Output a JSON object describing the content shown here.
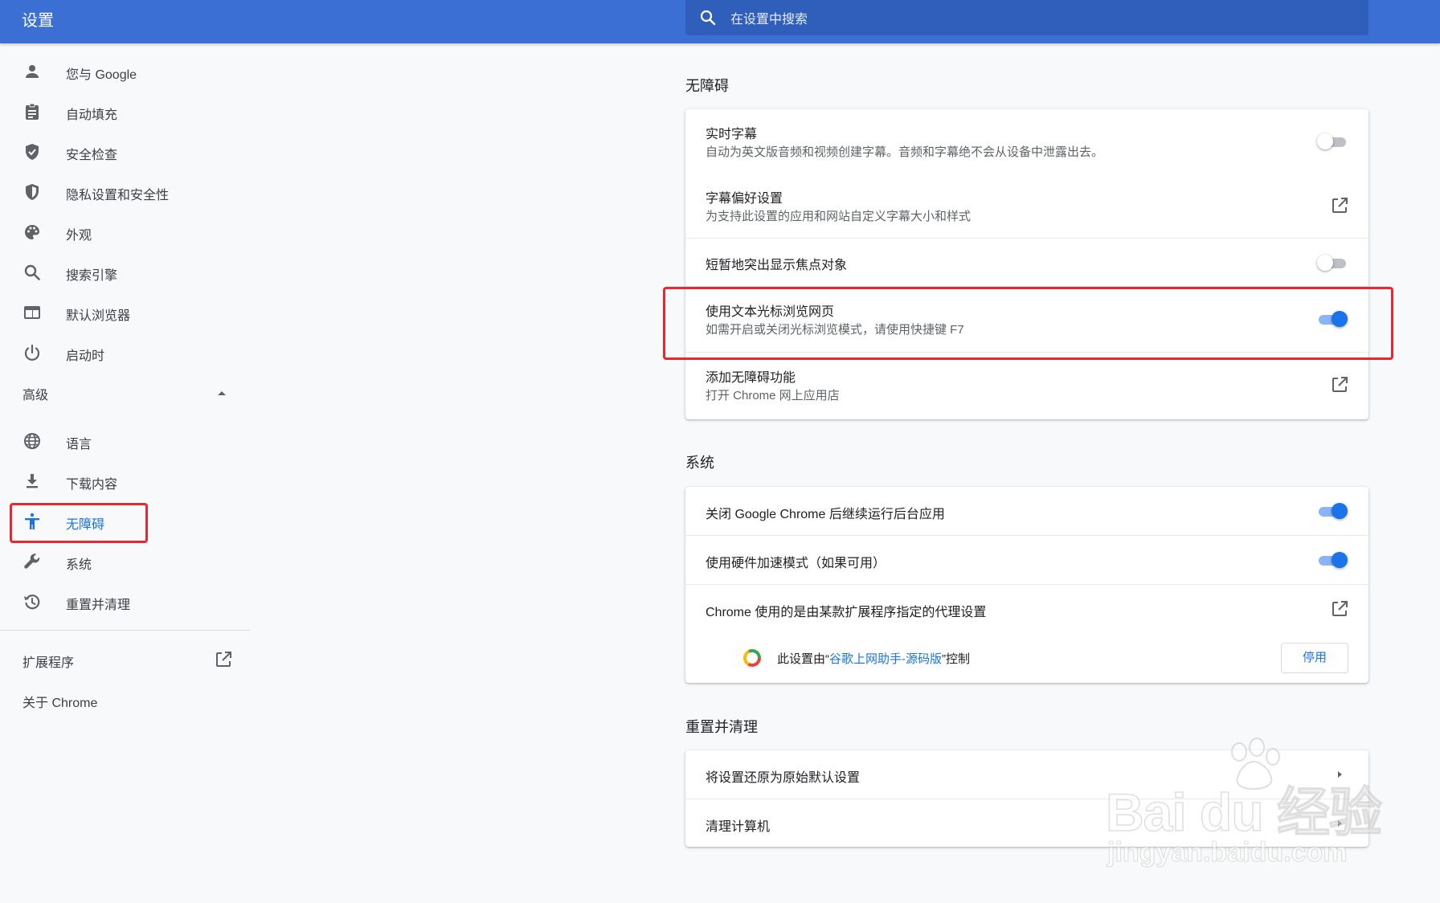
{
  "header": {
    "title": "设置",
    "search_placeholder": "在设置中搜索"
  },
  "sidebar": {
    "items": [
      {
        "label": "您与 Google",
        "icon": "person-icon"
      },
      {
        "label": "自动填充",
        "icon": "clipboard-icon"
      },
      {
        "label": "安全检查",
        "icon": "shield-check-icon"
      },
      {
        "label": "隐私设置和安全性",
        "icon": "shield-half-icon"
      },
      {
        "label": "外观",
        "icon": "palette-icon"
      },
      {
        "label": "搜索引擎",
        "icon": "search-icon"
      },
      {
        "label": "默认浏览器",
        "icon": "browser-window-icon"
      },
      {
        "label": "启动时",
        "icon": "power-icon"
      }
    ],
    "advanced_label": "高级",
    "advanced_items": [
      {
        "label": "语言",
        "icon": "globe-icon"
      },
      {
        "label": "下载内容",
        "icon": "download-icon"
      },
      {
        "label": "无障碍",
        "icon": "accessibility-icon",
        "active": true
      },
      {
        "label": "系统",
        "icon": "wrench-icon"
      },
      {
        "label": "重置并清理",
        "icon": "restore-icon"
      }
    ],
    "extensions_label": "扩展程序",
    "about_label": "关于 Chrome"
  },
  "accessibility": {
    "title": "无障碍",
    "rows": [
      {
        "title": "实时字幕",
        "subtitle": "自动为英文版音频和视频创建字幕。音频和字幕绝不会从设备中泄露出去。",
        "control": "toggle",
        "on": false
      },
      {
        "title": "字幕偏好设置",
        "subtitle": "为支持此设置的应用和网站自定义字幕大小和样式",
        "control": "external-link"
      },
      {
        "title": "短暂地突出显示焦点对象",
        "control": "toggle",
        "on": false
      },
      {
        "title": "使用文本光标浏览网页",
        "subtitle": "如需开启或关闭光标浏览模式，请使用快捷键 F7",
        "control": "toggle",
        "on": true
      },
      {
        "title": "添加无障碍功能",
        "subtitle": "打开 Chrome 网上应用店",
        "control": "external-link"
      }
    ]
  },
  "system": {
    "title": "系统",
    "rows": [
      {
        "title": "关闭 Google Chrome 后继续运行后台应用",
        "control": "toggle",
        "on": true
      },
      {
        "title": "使用硬件加速模式（如果可用）",
        "control": "toggle",
        "on": true
      },
      {
        "title": "Chrome 使用的是由某款扩展程序指定的代理设置",
        "control": "external-link"
      }
    ],
    "policy": {
      "prefix": "此设置由“",
      "extension_name": "谷歌上网助手-源码版",
      "suffix": "”控制",
      "button_label": "停用"
    }
  },
  "reset": {
    "title": "重置并清理",
    "rows": [
      {
        "title": "将设置还原为原始默认设置",
        "control": "arrow"
      },
      {
        "title": "清理计算机",
        "control": "arrow"
      }
    ]
  },
  "watermark": {
    "brand": "Bai du 经验",
    "url": "jingyan.baidu.com"
  },
  "colors": {
    "header_blue": "#3b6fd4",
    "accent_blue": "#1a73e8",
    "highlight_red": "#e8282e"
  }
}
